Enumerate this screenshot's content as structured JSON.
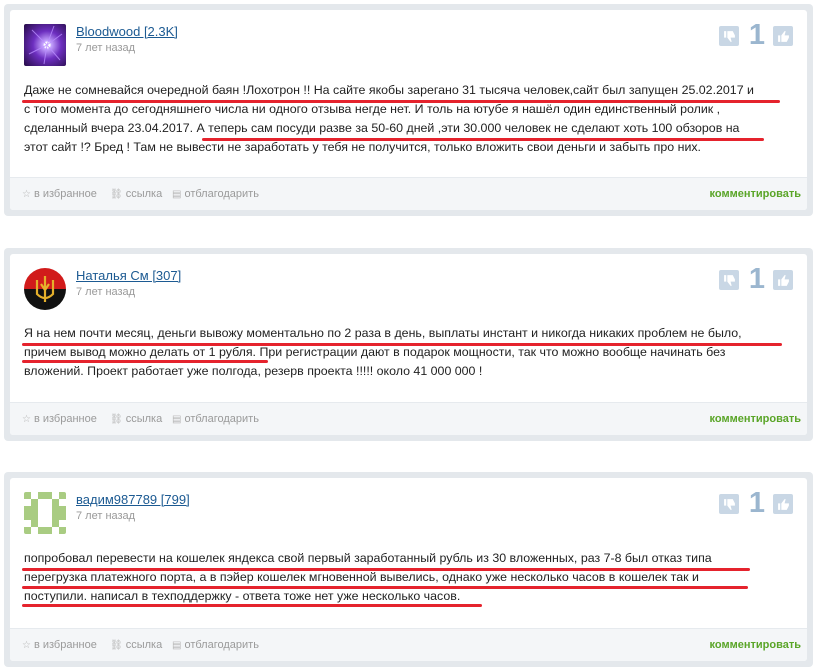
{
  "comments": [
    {
      "author": "Bloodwood [2.3K]",
      "time": "7 лет назад",
      "votes": "1",
      "lines": [
        "Даже не сомневайся очередной баян !Лохотрон !! На сайте якобы зарегано 31 тысяча человек,сайт был запущен 25.02.2017 и",
        "с того момента до сегодняшнего числа ни одного отзыва негде нет. И толь на ютубе я нашёл один единственный ролик ,",
        "сделанный вчера 23.04.2017. А теперь сам посуди разве за 50-60 дней ,эти 30.000 человек не сделают хоть 100 обзоров на",
        "этот сайт !? Бред ! Там не вывести не заработать у тебя не получится, только вложить свои деньги и забыть про них."
      ]
    },
    {
      "author": "Наталья См [307]",
      "time": "7 лет назад",
      "votes": "1",
      "lines": [
        "Я на нем почти месяц, деньги вывожу моментально по 2 раза в день, выплаты инстант и никогда никаких проблем не было,",
        "причем вывод можно делать от 1 рубля. При регистрации дают в подарок мощности, так что можно вообще начинать без",
        "вложений. Проект работает уже полгода, резерв проекта !!!!! около 41 000 000 !"
      ]
    },
    {
      "author": "вадим987789 [799]",
      "time": "7 лет назад",
      "votes": "1",
      "lines": [
        "попробовал перевести на кошелек яндекса свой первый заработанный рубль из 30 вложенных, раз 7-8 был отказ типа",
        "перегрузка платежного порта, а в пэйер кошелек мгновенной вывелись, однако уже несколько часов в кошелек так и",
        "поступили. написал в техподдержку - ответа тоже нет уже несколько часов."
      ]
    }
  ],
  "footer": {
    "favorite": "в избранное",
    "link": "ссылка",
    "thank": "отблагодарить",
    "comment": "комментировать"
  },
  "colors": {
    "author_link": "#1c5a92",
    "vote_count": "#9bb6cf",
    "underline": "#e5232d",
    "comment_button": "#5aa528"
  }
}
